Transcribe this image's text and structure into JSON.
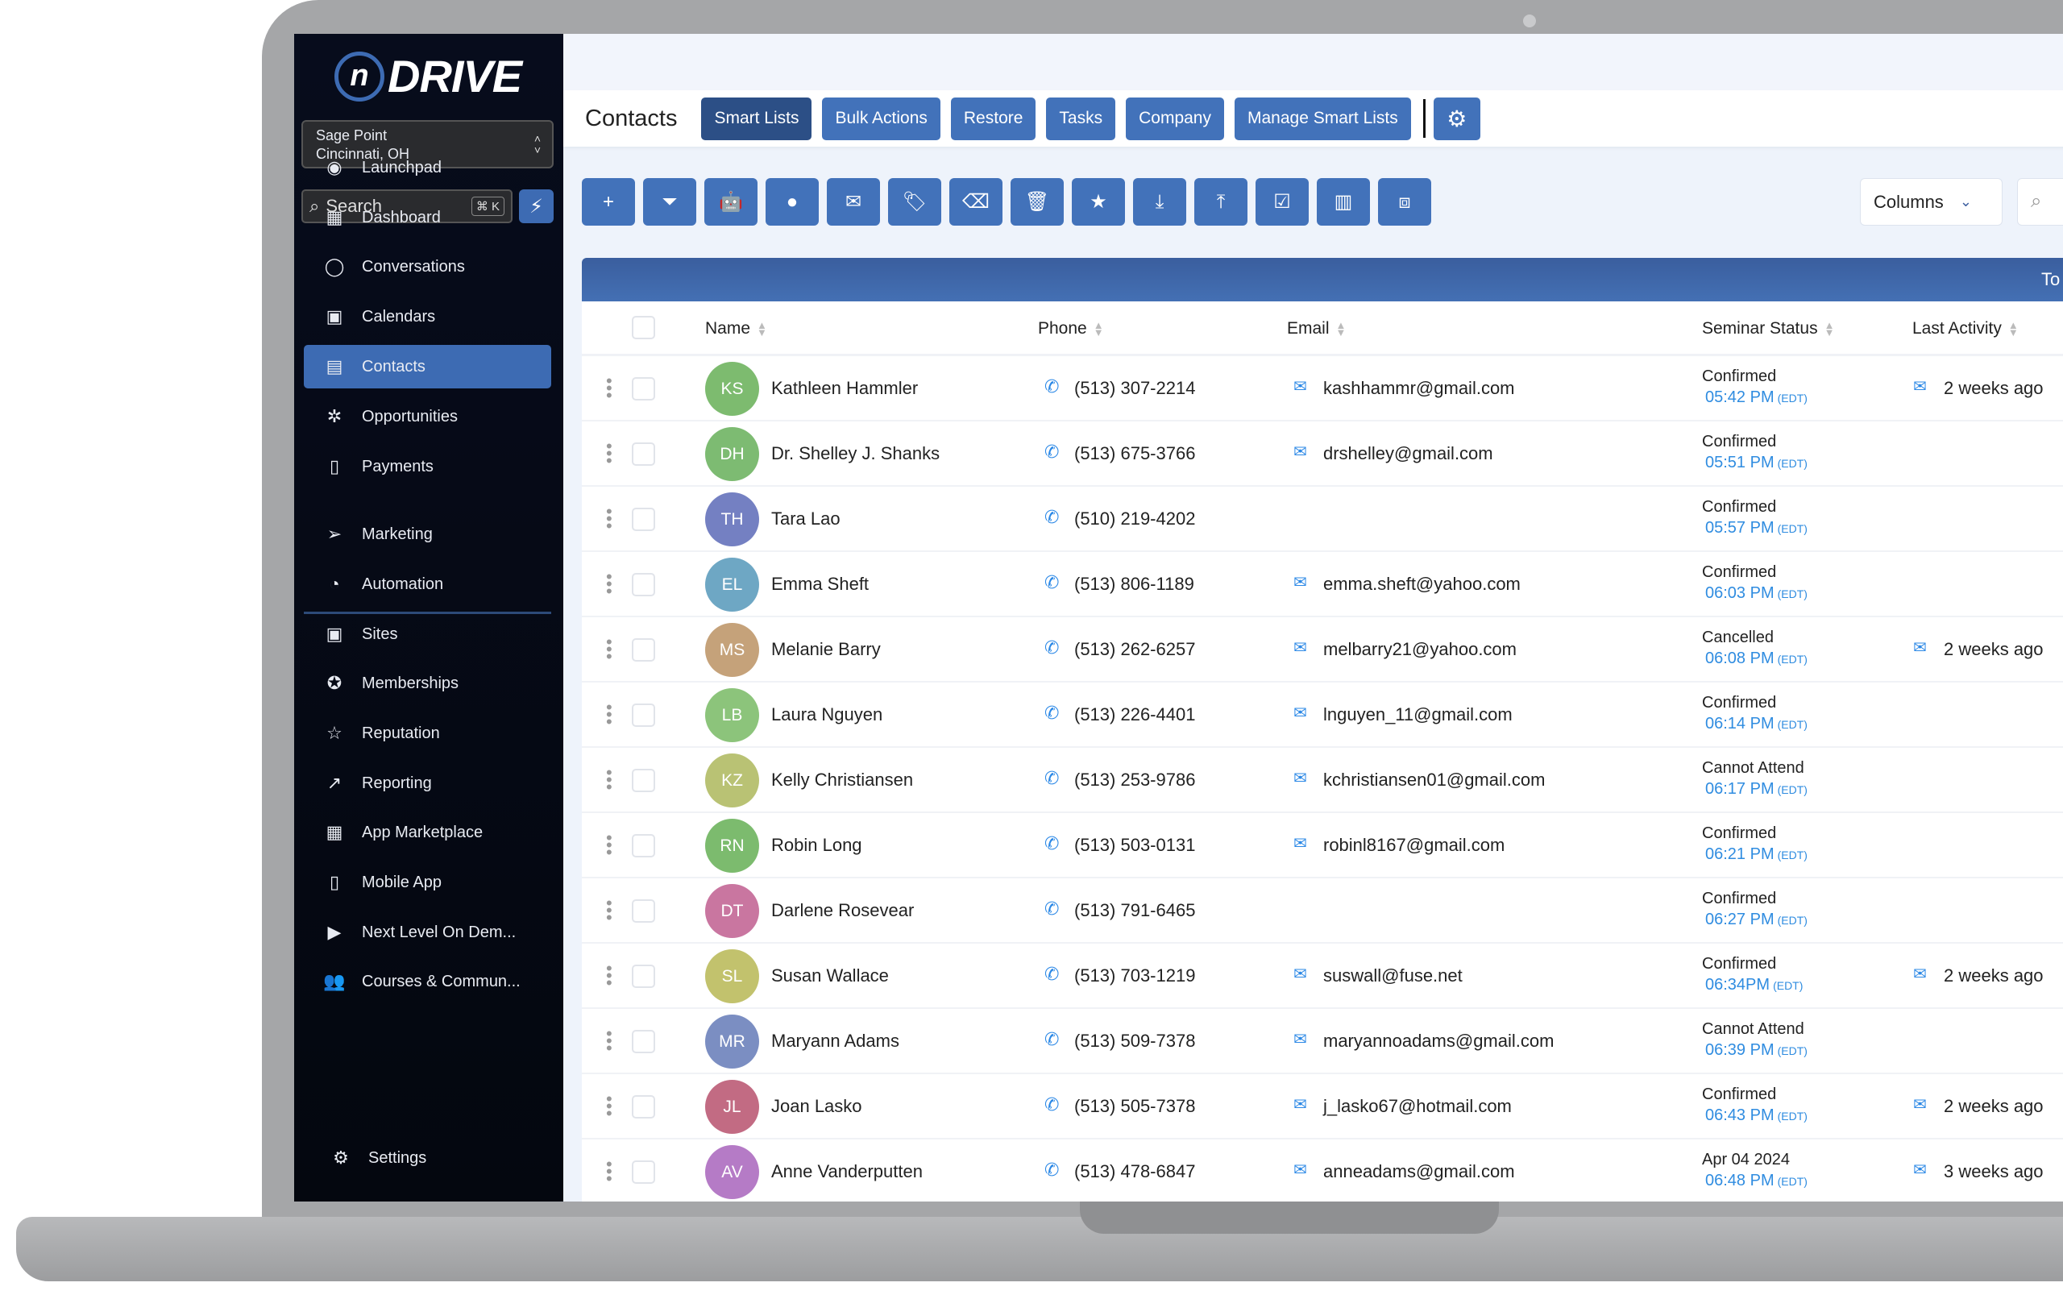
{
  "brand": {
    "logo_letter": "n",
    "logo_word": "DRIVE",
    "accent": "#3d6bb3"
  },
  "location": {
    "name": "Sage Point",
    "city": "Cincinnati, OH"
  },
  "search": {
    "placeholder": "Search",
    "shortcut": "⌘ K"
  },
  "sidebar": {
    "items": [
      {
        "label": "Launchpad",
        "icon": "rocket-icon",
        "glyph": "◉"
      },
      {
        "label": "Dashboard",
        "icon": "dashboard-icon",
        "glyph": "▦"
      },
      {
        "label": "Conversations",
        "icon": "chat-icon",
        "glyph": "◯"
      },
      {
        "label": "Calendars",
        "icon": "calendar-icon",
        "glyph": "▣"
      },
      {
        "label": "Contacts",
        "icon": "contacts-icon",
        "glyph": "▤",
        "active": true
      },
      {
        "label": "Opportunities",
        "icon": "opportunities-icon",
        "glyph": "✲"
      },
      {
        "label": "Payments",
        "icon": "payments-icon",
        "glyph": "▯"
      },
      {
        "label": "Marketing",
        "icon": "send-icon",
        "glyph": "➢"
      },
      {
        "label": "Automation",
        "icon": "automation-icon",
        "glyph": "◔"
      },
      {
        "label": "Sites",
        "icon": "sites-icon",
        "glyph": "▣"
      },
      {
        "label": "Memberships",
        "icon": "badge-icon",
        "glyph": "✪"
      },
      {
        "label": "Reputation",
        "icon": "star-icon",
        "glyph": "☆"
      },
      {
        "label": "Reporting",
        "icon": "trend-icon",
        "glyph": "↗"
      },
      {
        "label": "App Marketplace",
        "icon": "apps-icon",
        "glyph": "▦"
      },
      {
        "label": "Mobile App",
        "icon": "mobile-icon",
        "glyph": "▯"
      },
      {
        "label": "Next Level On Dem...",
        "icon": "video-icon",
        "glyph": "▶"
      },
      {
        "label": "Courses & Commun...",
        "icon": "community-icon",
        "glyph": "👥"
      }
    ],
    "settings": {
      "label": "Settings",
      "icon": "gear-icon"
    }
  },
  "header": {
    "title": "Contacts",
    "tabs": [
      "Smart Lists",
      "Bulk Actions",
      "Restore",
      "Tasks",
      "Company",
      "Manage Smart Lists"
    ],
    "active_tab": "Smart Lists"
  },
  "toolbar": {
    "icons": [
      {
        "name": "add-icon",
        "glyph": "+"
      },
      {
        "name": "filter-icon",
        "glyph": "⏷"
      },
      {
        "name": "robot-icon",
        "glyph": "🤖"
      },
      {
        "name": "sms-icon",
        "glyph": "●"
      },
      {
        "name": "email-icon",
        "glyph": "✉"
      },
      {
        "name": "tag-icon",
        "glyph": "🏷"
      },
      {
        "name": "remove-tag-icon",
        "glyph": "⌫"
      },
      {
        "name": "delete-icon",
        "glyph": "🗑"
      },
      {
        "name": "star-icon",
        "glyph": "★"
      },
      {
        "name": "import-icon",
        "glyph": "⤓"
      },
      {
        "name": "export-icon",
        "glyph": "⤒"
      },
      {
        "name": "review-icon",
        "glyph": "☑"
      },
      {
        "name": "company-icon",
        "glyph": "▥"
      },
      {
        "name": "merge-icon",
        "glyph": "⧈"
      }
    ]
  },
  "columns_label": "Columns",
  "band_text": "To",
  "table": {
    "headers": [
      "Name",
      "Phone",
      "Email",
      "Seminar Status",
      "Last Activity"
    ],
    "rows": [
      {
        "initials": "KS",
        "color": "#7dbb6f",
        "name": "Kathleen Hammler",
        "phone": "(513) 307-2214",
        "email": "kashhammr@gmail.com",
        "status": "Confirmed",
        "time": "05:42 PM",
        "tz": "(EDT)",
        "activity": "2 weeks ago"
      },
      {
        "initials": "DH",
        "color": "#7dbb72",
        "name": "Dr. Shelley J. Shanks",
        "phone": "(513) 675-3766",
        "email": "drshelley@gmail.com",
        "status": "Confirmed",
        "time": "05:51 PM",
        "tz": "(EDT)",
        "activity": ""
      },
      {
        "initials": "TH",
        "color": "#7480c2",
        "name": "Tara Lao",
        "phone": "(510) 219-4202",
        "email": "",
        "status": "Confirmed",
        "time": "05:57 PM",
        "tz": "(EDT)",
        "activity": ""
      },
      {
        "initials": "EL",
        "color": "#6ea7c4",
        "name": "Emma Sheft",
        "phone": "(513) 806-1189",
        "email": "emma.sheft@yahoo.com",
        "status": "Confirmed",
        "time": "06:03 PM",
        "tz": "(EDT)",
        "activity": ""
      },
      {
        "initials": "MS",
        "color": "#c5a27a",
        "name": "Melanie Barry",
        "phone": "(513) 262-6257",
        "email": "melbarry21@yahoo.com",
        "status": "Cancelled",
        "time": "06:08 PM",
        "tz": "(EDT)",
        "activity": "2 weeks ago"
      },
      {
        "initials": "LB",
        "color": "#8cc47b",
        "name": "Laura Nguyen",
        "phone": "(513) 226-4401",
        "email": "lnguyen_11@gmail.com",
        "status": "Confirmed",
        "time": "06:14 PM",
        "tz": "(EDT)",
        "activity": ""
      },
      {
        "initials": "KZ",
        "color": "#b9c274",
        "name": "Kelly Christiansen",
        "phone": "(513) 253-9786",
        "email": "kchristiansen01@gmail.com",
        "status": "Cannot Attend",
        "time": "06:17 PM",
        "tz": "(EDT)",
        "activity": ""
      },
      {
        "initials": "RN",
        "color": "#7cbb6e",
        "name": "Robin Long",
        "phone": "(513) 503-0131",
        "email": "robinl8167@gmail.com",
        "status": "Confirmed",
        "time": "06:21 PM",
        "tz": "(EDT)",
        "activity": ""
      },
      {
        "initials": "DT",
        "color": "#c976a0",
        "name": "Darlene Rosevear",
        "phone": "(513) 791-6465",
        "email": "",
        "status": "Confirmed",
        "time": "06:27 PM",
        "tz": "(EDT)",
        "activity": ""
      },
      {
        "initials": "SL",
        "color": "#c2c26d",
        "name": "Susan Wallace",
        "phone": "(513) 703-1219",
        "email": "suswall@fuse.net",
        "status": "Confirmed",
        "time": "06:34PM",
        "tz": "(EDT)",
        "activity": "2 weeks ago"
      },
      {
        "initials": "MR",
        "color": "#7b8ec2",
        "name": "Maryann Adams",
        "phone": "(513) 509-7378",
        "email": "maryannoadams@gmail.com",
        "status": "Cannot Attend",
        "time": "06:39 PM",
        "tz": "(EDT)",
        "activity": ""
      },
      {
        "initials": "JL",
        "color": "#c26b83",
        "name": "Joan Lasko",
        "phone": "(513) 505-7378",
        "email": "j_lasko67@hotmail.com",
        "status": "Confirmed",
        "time": "06:43 PM",
        "tz": "(EDT)",
        "activity": "2 weeks ago"
      },
      {
        "initials": "AV",
        "color": "#b57bc6",
        "name": "Anne Vanderputten",
        "phone": "(513) 478-6847",
        "email": "anneadams@gmail.com",
        "status": "Apr 04 2024",
        "time": "06:48 PM",
        "tz": "(EDT)",
        "activity": "3 weeks ago"
      }
    ]
  }
}
